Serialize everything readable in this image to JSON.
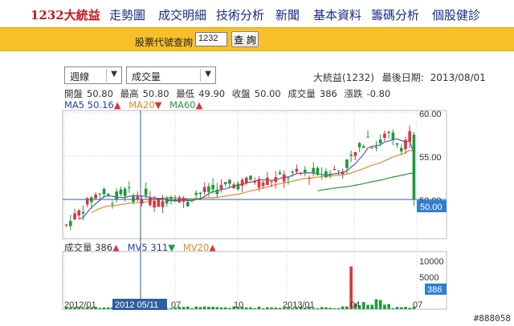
{
  "nav": {
    "brand": "1232大統益",
    "items": [
      "走勢圖",
      "成交明細",
      "技術分析",
      "新聞",
      "基本資料",
      "籌碼分析",
      "個股健診"
    ]
  },
  "query": {
    "label": "股票代號查詢",
    "value": "1232",
    "button": "查 詢"
  },
  "selectors": {
    "period": "週線",
    "indicator": "成交量"
  },
  "info": {
    "stock": "大統益(1232)",
    "last_date_label": "最後日期:",
    "last_date": "2013/08/01"
  },
  "quote": {
    "open_label": "開盤",
    "open": "50.80",
    "high_label": "最高",
    "high": "50.80",
    "low_label": "最低",
    "low": "49.90",
    "close_label": "收盤",
    "close": "50.00",
    "vol_label": "成交量",
    "vol": "386",
    "chg_label": "漲跌",
    "chg": "-0.80"
  },
  "ma": {
    "ma5_label": "MA5",
    "ma5_value": "50.16",
    "ma5_arrow": "▲",
    "ma20_label": "MA20",
    "ma20_arrow": "▼",
    "ma60_label": "MA60",
    "ma60_arrow": "▲"
  },
  "volume_legend": {
    "vol_label": "成交量",
    "vol_value": "386",
    "vol_arrow": "▲",
    "mv5_label": "MV5",
    "mv5_value": "311",
    "mv5_arrow": "▼",
    "mv20_label": "MV20",
    "mv20_arrow": "▲"
  },
  "colors": {
    "up": "#d9363e",
    "down": "#1f9a3a",
    "ma5": "#2b3fa8",
    "ma20": "#e8882a",
    "ma60": "#2a9a3a",
    "volume": "#1f9a3a",
    "axis_tag": "#2f7fd0",
    "nav_bar": "#f7bf2a"
  },
  "price_axis": {
    "ticks": [
      "60.00",
      "55.00",
      "50.00"
    ],
    "current_tag": "50.00"
  },
  "volume_axis": {
    "ticks": [
      "10000",
      "5000"
    ],
    "current_tag": "386"
  },
  "x_axis": {
    "ticks": [
      "2012/01",
      "07",
      "10",
      "2013/01",
      "04",
      "07"
    ],
    "crosshair_tag": "2012 05/11"
  },
  "watermark": "#888058"
}
